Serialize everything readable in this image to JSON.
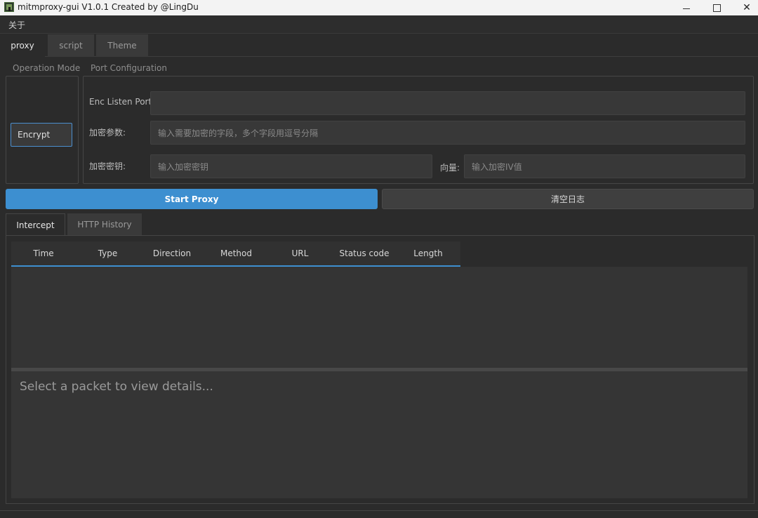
{
  "window": {
    "title": "mitmproxy-gui V1.0.1 Created by @LingDu",
    "close_glyph": "✕"
  },
  "menu": {
    "about": "关于"
  },
  "tabs": [
    {
      "label": "proxy",
      "active": true
    },
    {
      "label": "script",
      "active": false
    },
    {
      "label": "Theme",
      "active": false
    }
  ],
  "operation_mode": {
    "title": "Operation Mode",
    "encrypt_label": "Encrypt"
  },
  "port_config": {
    "title": "Port Configuration",
    "listen_port_label": "Enc Listen Port:",
    "listen_port_value": "",
    "params_label": "加密参数:",
    "params_placeholder": "输入需要加密的字段，多个字段用逗号分隔",
    "key_label": "加密密钥:",
    "key_placeholder": "输入加密密钥",
    "iv_label": "向量:",
    "iv_placeholder": "输入加密IV值"
  },
  "actions": {
    "start_proxy": "Start Proxy",
    "clear_log": "清空日志"
  },
  "subtabs": [
    {
      "label": "Intercept",
      "active": true
    },
    {
      "label": "HTTP History",
      "active": false
    }
  ],
  "table": {
    "columns": [
      "Time",
      "Type",
      "Direction",
      "Method",
      "URL",
      "Status code",
      "Length"
    ],
    "rows": []
  },
  "details": {
    "placeholder": "Select a packet to view details..."
  },
  "colors": {
    "accent": "#3d8fd0",
    "background": "#2b2b2b"
  }
}
